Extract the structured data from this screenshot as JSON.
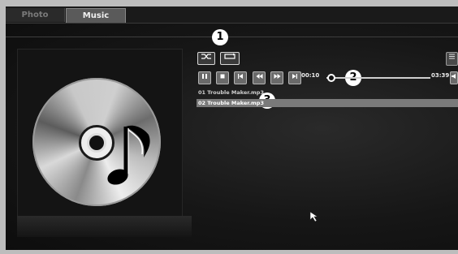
{
  "tabs": [
    {
      "label": "Photo",
      "active": false
    },
    {
      "label": "Music",
      "active": true
    }
  ],
  "callouts": [
    "1",
    "2",
    "3"
  ],
  "playback": {
    "current_time": "00:10",
    "total_time": "03:39",
    "progress": 0.05
  },
  "controls": [
    {
      "icon": "pause-icon"
    },
    {
      "icon": "stop-icon"
    },
    {
      "icon": "skip-previous-icon"
    },
    {
      "icon": "rewind-icon"
    },
    {
      "icon": "fast-forward-icon"
    },
    {
      "icon": "skip-next-icon"
    }
  ],
  "playlist": [
    {
      "label": "01 Trouble Maker.mp3",
      "selected": false
    },
    {
      "label": "02 Trouble Maker.mp3",
      "selected": true
    }
  ],
  "colors": {
    "accent": "#7a7a7a",
    "text": "#ffffff"
  }
}
